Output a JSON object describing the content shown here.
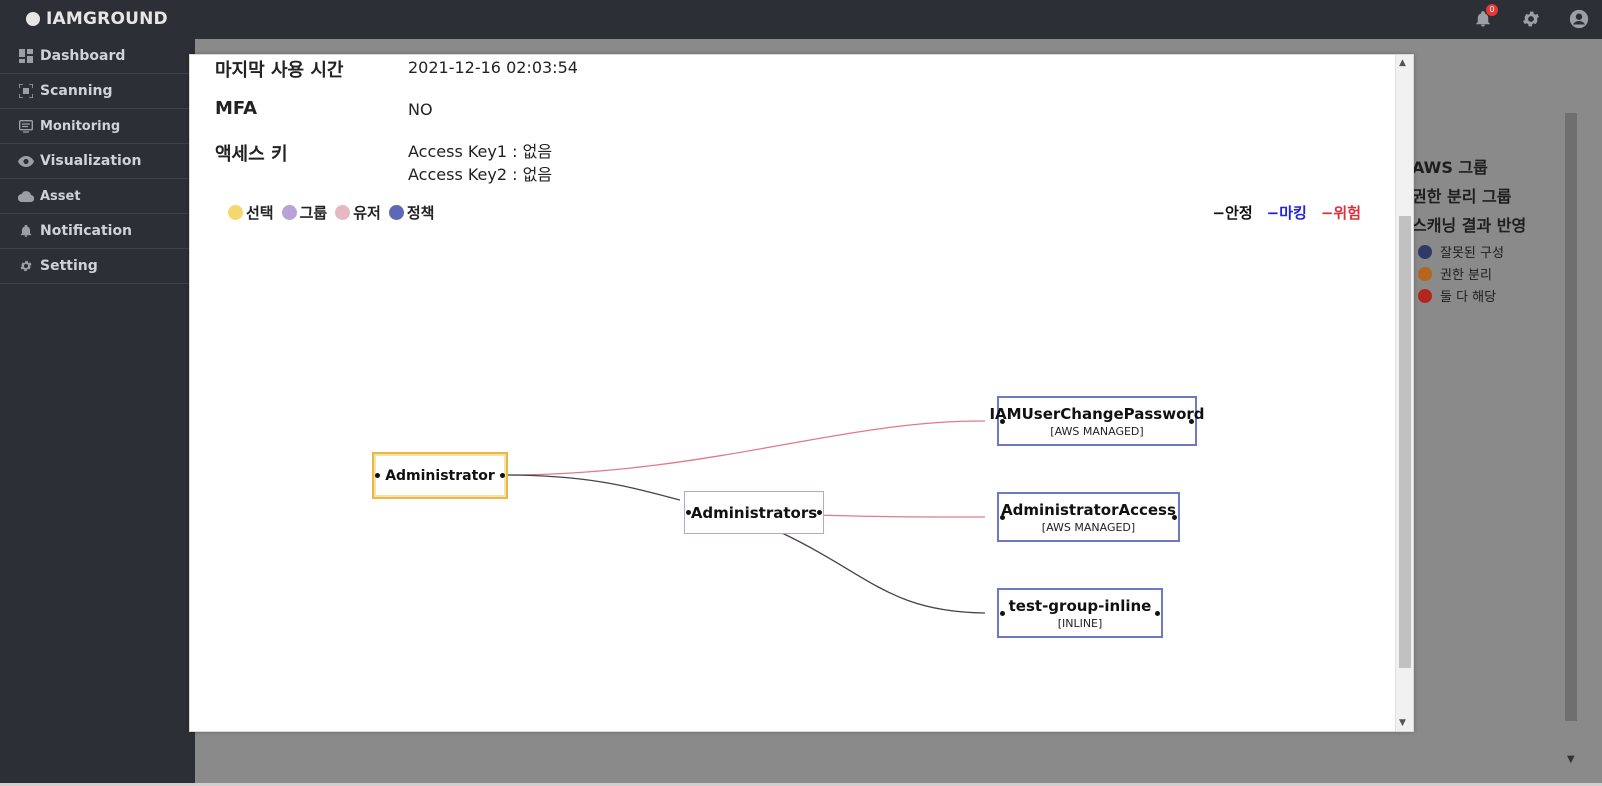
{
  "app": {
    "title": "IAMGROUND",
    "notification_count": "0"
  },
  "sidebar": {
    "items": [
      {
        "label": "Dashboard",
        "icon": "dashboard-icon"
      },
      {
        "label": "Scanning",
        "icon": "scan-icon"
      },
      {
        "label": "Monitoring",
        "icon": "monitor-icon"
      },
      {
        "label": "Visualization",
        "icon": "eye-icon"
      },
      {
        "label": "Asset",
        "icon": "cloud-icon"
      },
      {
        "label": "Notification",
        "icon": "bell-icon"
      },
      {
        "label": "Setting",
        "icon": "gear-icon"
      }
    ]
  },
  "background_panel": {
    "lines": [
      "AWS 그룹",
      "권한 분리 그룹",
      "스캐닝 결과 반영"
    ],
    "legend": [
      {
        "label": "잘못된 구성",
        "color": "#2f3b66"
      },
      {
        "label": "권한 분리",
        "color": "#b5651d"
      },
      {
        "label": "둘 다 해당",
        "color": "#b3261e"
      }
    ]
  },
  "modal": {
    "last_used": {
      "label": "마지막 사용 시간",
      "value": "2021-12-16 02:03:54"
    },
    "mfa": {
      "label": "MFA",
      "value": "NO"
    },
    "access_keys": {
      "label": "액세스 키",
      "key1": "Access Key1 : 없음",
      "key2": "Access Key2 : 없음"
    },
    "node_legend": [
      {
        "label": "선택",
        "color": "#f5d76e"
      },
      {
        "label": "그룹",
        "color": "#b9a3d6"
      },
      {
        "label": "유저",
        "color": "#e6b8c2"
      },
      {
        "label": "정책",
        "color": "#5b6ab8"
      }
    ],
    "edge_legend": [
      {
        "label": "안정",
        "color": "#111111"
      },
      {
        "label": "마킹",
        "color": "#2222dd"
      },
      {
        "label": "위험",
        "color": "#d9303e"
      }
    ],
    "nodes": {
      "administrator": {
        "name": "Administrator"
      },
      "administrators": {
        "name": "Administrators"
      },
      "iam_user_change_password": {
        "name": "IAMUserChangePassword",
        "tag": "[AWS MANAGED]"
      },
      "administrator_access": {
        "name": "AdministratorAccess",
        "tag": "[AWS MANAGED]"
      },
      "test_group_inline": {
        "name": "test-group-inline",
        "tag": "[INLINE]"
      }
    },
    "edges": [
      {
        "from": "Administrator",
        "to": "IAMUserChangePassword",
        "status": "위험"
      },
      {
        "from": "Administrator",
        "to": "Administrators",
        "status": "안정"
      },
      {
        "from": "Administrators",
        "to": "AdministratorAccess",
        "status": "위험"
      },
      {
        "from": "Administrators",
        "to": "test-group-inline",
        "status": "안정"
      }
    ]
  }
}
